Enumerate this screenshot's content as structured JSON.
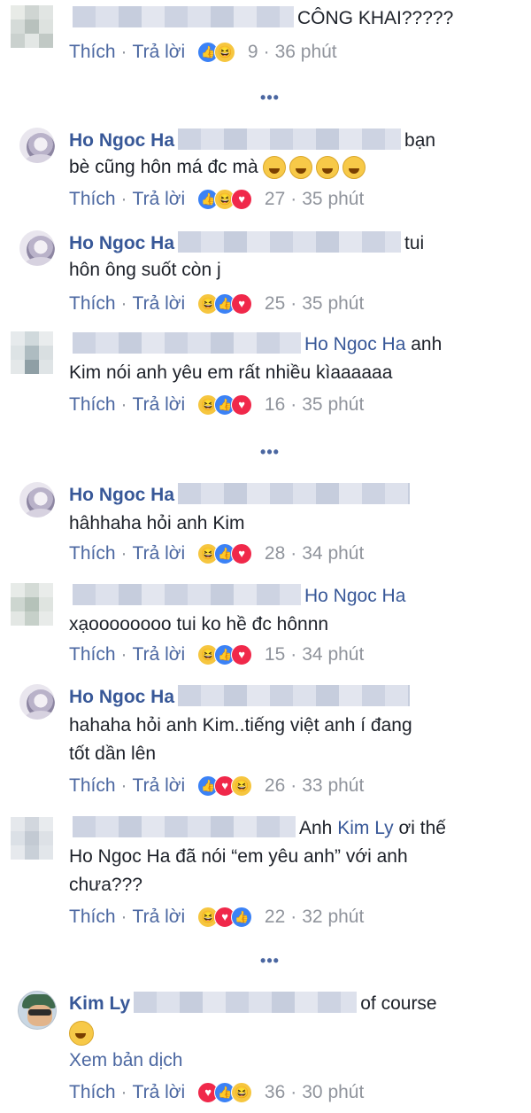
{
  "labels": {
    "like": "Thích",
    "reply": "Trả lời",
    "more": "•••",
    "translate": "Xem bản dịch"
  },
  "colors": {
    "name": "#385898",
    "meta": "#90949c",
    "link": "#4b67a1",
    "like": "#3b82f6",
    "haha": "#f6c63f",
    "love": "#f0284a"
  },
  "comments": [
    {
      "author": "",
      "text1": "CÔNG KHAI?????",
      "count": "9",
      "time": "36 phút",
      "reactions": [
        "like-icon",
        "haha-icon"
      ]
    },
    {
      "author": "Ho Ngoc Ha",
      "text1": "bạn",
      "text2": "bè cũng hôn má đc mà",
      "emoji": [
        "grinning-sweat-icon",
        "grinning-sweat-icon",
        "grinning-sweat-icon",
        "grinning-sweat-icon"
      ],
      "count": "27",
      "time": "35 phút",
      "reactions": [
        "like-icon",
        "haha-icon",
        "love-icon"
      ]
    },
    {
      "author": "Ho Ngoc Ha",
      "text1": "tui",
      "text2": "hôn ông suốt còn j",
      "count": "25",
      "time": "35 phút",
      "reactions": [
        "haha-icon",
        "like-icon",
        "love-icon"
      ]
    },
    {
      "author": "",
      "tag": "Ho Ngoc Ha",
      "text1": "anh",
      "text2": "Kim nói anh yêu em rất nhiều kìaaaaaa",
      "count": "16",
      "time": "35 phút",
      "reactions": [
        "haha-icon",
        "like-icon",
        "love-icon"
      ]
    },
    {
      "author": "Ho Ngoc Ha",
      "text2": "hâhhaha hỏi anh Kim",
      "count": "28",
      "time": "34 phút",
      "reactions": [
        "haha-icon",
        "like-icon",
        "love-icon"
      ]
    },
    {
      "author": "",
      "tag": "Ho Ngoc Ha",
      "text2": "xạoooooooo tui ko hề đc hônnn",
      "count": "15",
      "time": "34 phút",
      "reactions": [
        "haha-icon",
        "like-icon",
        "love-icon"
      ]
    },
    {
      "author": "Ho Ngoc Ha",
      "text2": "hahaha hỏi anh Kim..tiếng việt anh í đang",
      "text3": "tốt dần lên",
      "count": "26",
      "time": "33 phút",
      "reactions": [
        "like-icon",
        "love-icon",
        "haha-icon"
      ]
    },
    {
      "author": "",
      "pre": "Anh",
      "tag": "Kim Ly",
      "text1": "ơi thế",
      "text2": "Ho Ngoc Ha đã nói “em yêu anh” với anh",
      "text3": "chưa???",
      "count": "22",
      "time": "32 phút",
      "reactions": [
        "haha-icon",
        "love-icon",
        "like-icon"
      ]
    },
    {
      "author": "Kim Ly",
      "text1": "of course",
      "emoji": [
        "smiley-icon"
      ],
      "count": "36",
      "time": "30 phút",
      "reactions": [
        "love-icon",
        "like-icon",
        "haha-icon"
      ]
    }
  ]
}
